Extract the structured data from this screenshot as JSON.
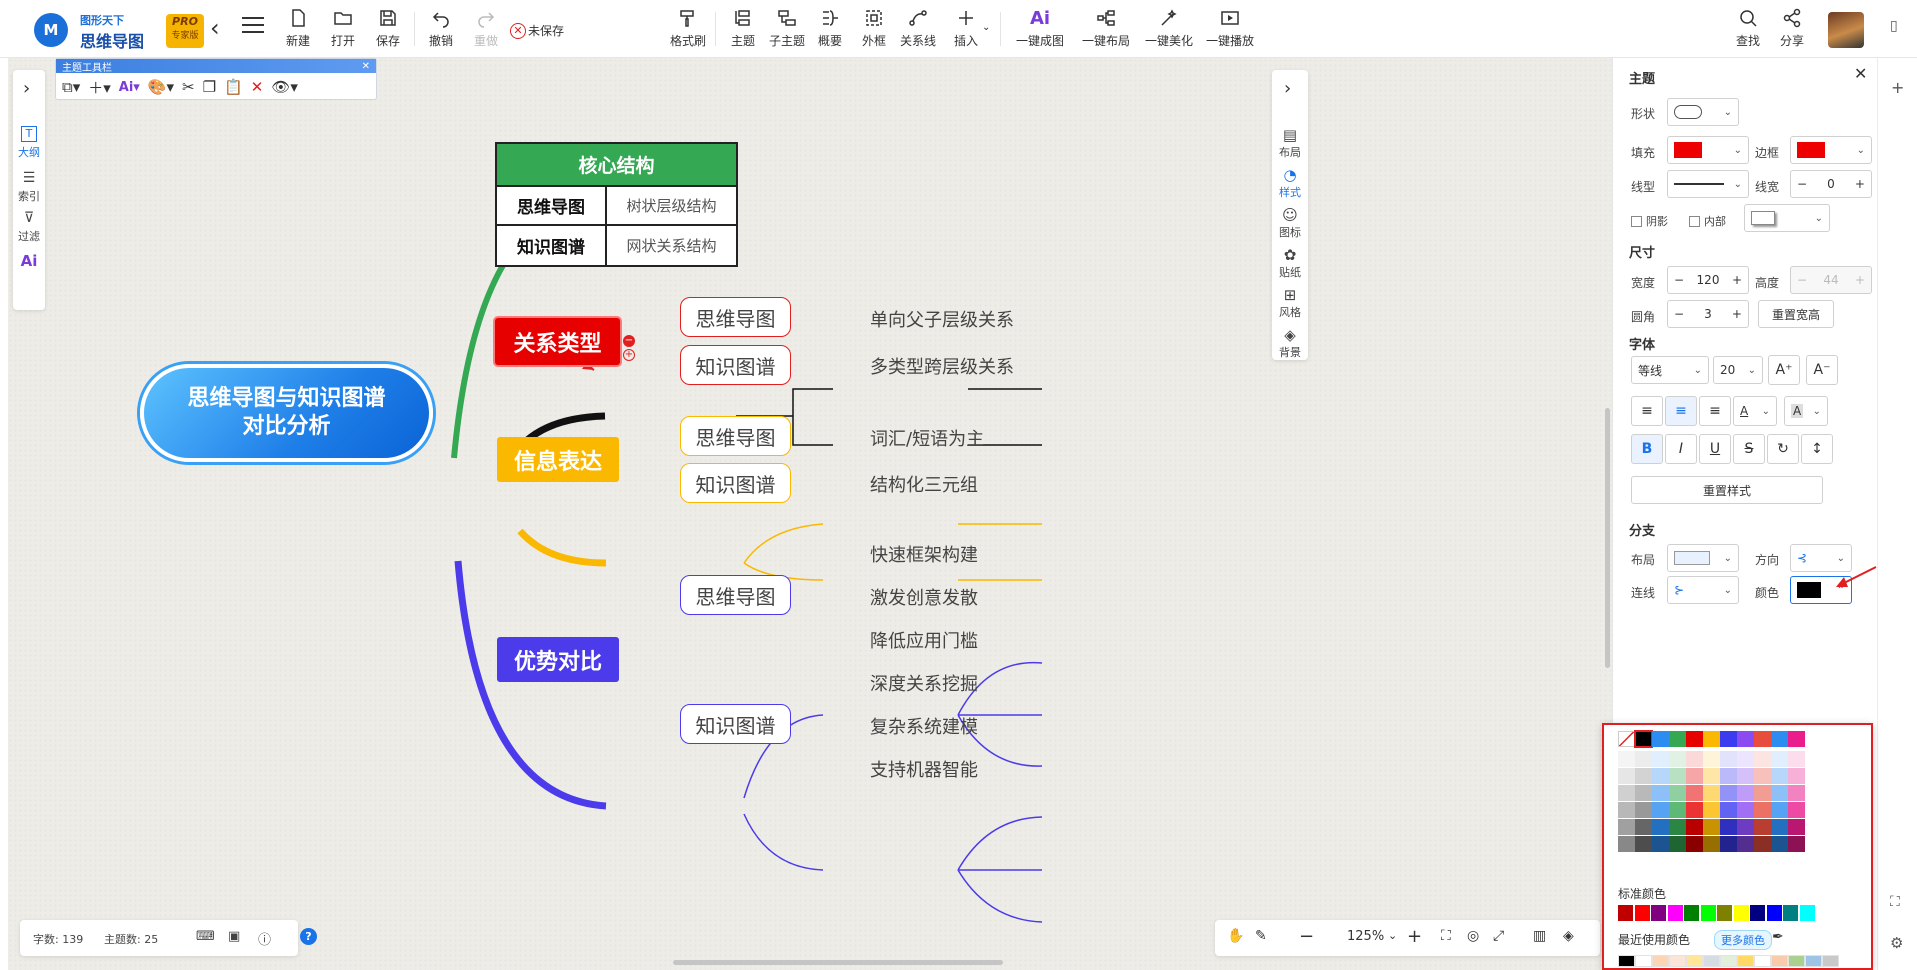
{
  "app": {
    "brand_top": "图形天下",
    "brand_name": "思维导图",
    "edition_badge": "PRO",
    "edition_label": "专家版",
    "unsaved": "未保存"
  },
  "toolbar": {
    "new": "新建",
    "open": "打开",
    "save": "保存",
    "undo": "撤销",
    "redo": "重做",
    "format_painter": "格式刷",
    "topic": "主题",
    "subtopic": "子主题",
    "summary": "概要",
    "boundary": "外框",
    "relation": "关系线",
    "insert": "插入",
    "ai_map": "一键成图",
    "auto_layout": "一键布局",
    "beautify": "一键美化",
    "play": "一键播放",
    "find": "查找",
    "share": "分享"
  },
  "left_nav": {
    "outline": "大纲",
    "index": "索引",
    "filter": "过滤"
  },
  "topic_toolbar": {
    "title": "主题工具栏"
  },
  "right_nav": {
    "layout": "布局",
    "style": "样式",
    "icon": "图标",
    "sticker": "贴纸",
    "theme": "风格",
    "background": "背景"
  },
  "mindmap": {
    "root": {
      "line1": "思维导图与知识图谱",
      "line2": "对比分析"
    },
    "table": {
      "header": "核心结构",
      "rows": [
        {
          "label": "思维导图",
          "value": "树状层级结构"
        },
        {
          "label": "知识图谱",
          "value": "网状关系结构"
        }
      ]
    },
    "branches": [
      {
        "label": "关系类型",
        "color": "#e60000",
        "children": [
          {
            "label": "思维导图",
            "leaves": [
              "单向父子层级关系"
            ]
          },
          {
            "label": "知识图谱",
            "leaves": [
              "多类型跨层级关系"
            ]
          }
        ]
      },
      {
        "label": "信息表达",
        "color": "#fbb800",
        "children": [
          {
            "label": "思维导图",
            "leaves": [
              "词汇/短语为主"
            ]
          },
          {
            "label": "知识图谱",
            "leaves": [
              "结构化三元组"
            ]
          }
        ]
      },
      {
        "label": "优势对比",
        "color": "#4b3bea",
        "children": [
          {
            "label": "思维导图",
            "leaves": [
              "快速框架构建",
              "激发创意发散",
              "降低应用门槛"
            ]
          },
          {
            "label": "知识图谱",
            "leaves": [
              "深度关系挖掘",
              "复杂系统建模",
              "支持机器智能"
            ]
          }
        ]
      }
    ]
  },
  "panel": {
    "topic_title": "主题",
    "shape_label": "形状",
    "fill_label": "填充",
    "fill_color": "#ee0000",
    "border_label": "边框",
    "border_color": "#ee0000",
    "line_type_label": "线型",
    "line_width_label": "线宽",
    "line_width": "0",
    "shadow_label": "阴影",
    "inner_label": "内部",
    "size_title": "尺寸",
    "width_label": "宽度",
    "width": "120",
    "height_label": "高度",
    "height": "44",
    "radius_label": "圆角",
    "radius": "3",
    "reset_size": "重置宽高",
    "font_title": "字体",
    "font_family": "等线",
    "font_size": "20",
    "reset_style": "重置样式",
    "branch_title": "分支",
    "branch_layout_label": "布局",
    "direction_label": "方向",
    "connector_label": "连线",
    "color_label": "颜色",
    "branch_color": "#000000"
  },
  "color_picker": {
    "standard_label": "标准颜色",
    "recent_label": "最近使用颜色",
    "more_colors": "更多颜色",
    "top_row": [
      "#000000",
      "#2d8cf0",
      "#34a853",
      "#e60000",
      "#fbb800",
      "#3b3bf0",
      "#8a4bf0",
      "#e74c3c",
      "#2d8cf0",
      "#e91e8c"
    ],
    "standard": [
      "#c00000",
      "#ff0000",
      "#800080",
      "#ff00ff",
      "#008000",
      "#00ff00",
      "#808000",
      "#ffff00",
      "#000080",
      "#0000ff",
      "#008080",
      "#00ffff"
    ]
  },
  "status": {
    "word_count": "字数: 139",
    "topic_count": "主题数: 25"
  },
  "zoom": {
    "level": "125%"
  }
}
